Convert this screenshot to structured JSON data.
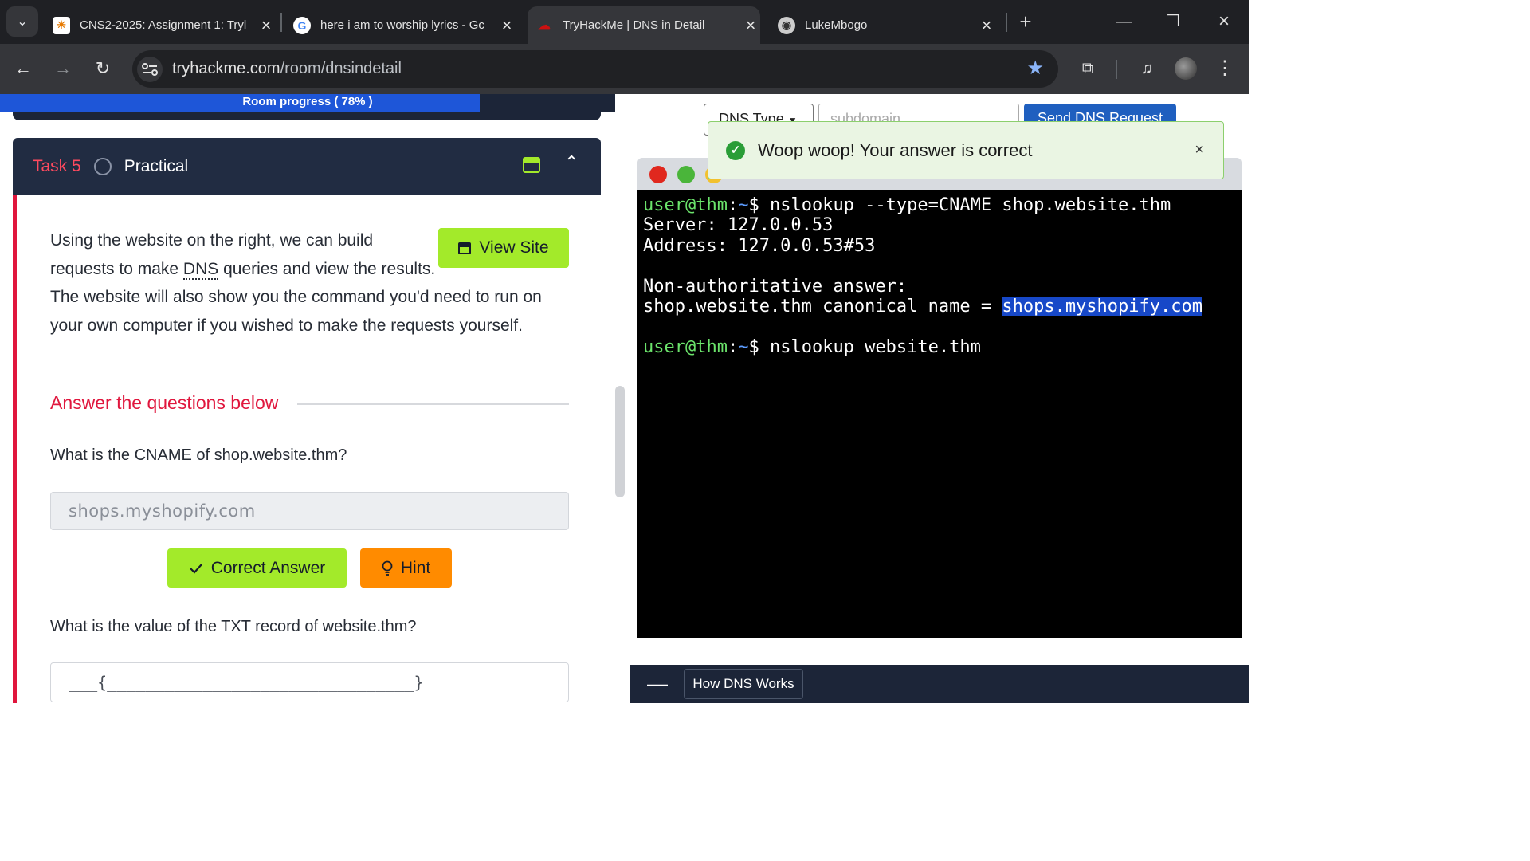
{
  "browser": {
    "tabs": [
      {
        "title": "CNS2-2025: Assignment 1: Tryl",
        "favicon": "moodle-icon"
      },
      {
        "title": "here i am to worship lyrics - Gc",
        "favicon": "google-icon"
      },
      {
        "title": "TryHackMe | DNS in Detail",
        "favicon": "tryhackme-icon"
      },
      {
        "title": "LukeMbogo",
        "favicon": "github-icon"
      }
    ],
    "active_tab": 2,
    "url_domain": "tryhackme.com",
    "url_path": "/room/dnsindetail"
  },
  "room": {
    "progress_label": "Room progress ( 78% )",
    "progress_value": 0.78
  },
  "task": {
    "number": "Task 5",
    "title": "Practical",
    "para_line1": "Using the website on the right, we can build",
    "para_line2_pre": "requests to make ",
    "para_line2_abbr": "DNS",
    "para_line2_post": " queries and view the results.",
    "para_line3": "The website will also show you the command you'd need to run on",
    "para_line4": "your own computer if you wished to make the requests yourself.",
    "view_site_label": "View Site",
    "answer_heading": "Answer the questions below",
    "q1": "What is the CNAME of shop.website.thm?",
    "a1": "shops.myshopify.com",
    "correct_label": "Correct Answer",
    "hint_label": "Hint",
    "q2": "What is the value of the TXT record of website.thm?",
    "a2_placeholder": "___{________________________________}"
  },
  "dns_tool": {
    "type_label": "DNS Type",
    "subdomain_placeholder": "subdomain",
    "send_label": "Send DNS Request"
  },
  "toast": {
    "message": "Woop woop! Your answer is correct"
  },
  "terminal": {
    "user": "user@thm",
    "sep": ":",
    "tilde": "~",
    "prompt_end": "$ ",
    "cmd1": "nslookup --type=CNAME shop.website.thm",
    "line_server": "Server: 127.0.0.53",
    "line_address": "Address: 127.0.0.53#53",
    "line_nonauth": "Non-authoritative answer:",
    "line_cname_pre": "shop.website.thm canonical name = ",
    "line_cname_val": "shops.myshopify.com",
    "cmd2": "nslookup website.thm"
  },
  "bottom": {
    "tab_label": "How DNS Works"
  },
  "colors": {
    "accent_green": "#a3ea2a",
    "accent_red": "#e0163d",
    "hint_orange": "#ff8b00",
    "navy": "#212c42",
    "terminal_user": "#6be36b"
  }
}
